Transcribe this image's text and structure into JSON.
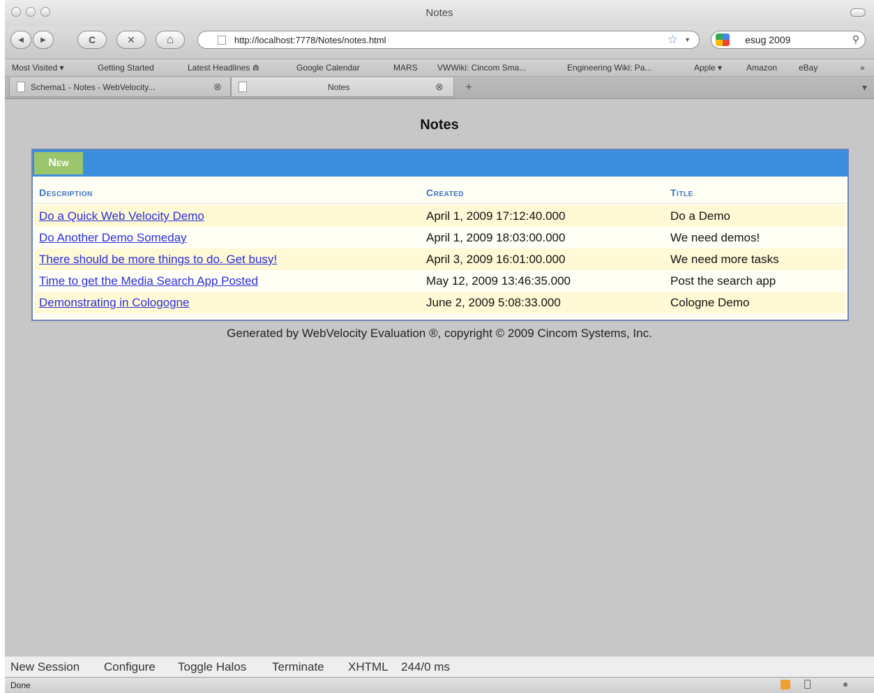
{
  "window": {
    "title": "Notes"
  },
  "toolbar": {
    "back_glyph": "◀",
    "forward_glyph": "▶",
    "reload_glyph": "C",
    "stop_glyph": "✕",
    "home_glyph": "⌂",
    "url": "http://localhost:7778/Notes/notes.html",
    "star_glyph": "☆",
    "dropdown_glyph": "▼",
    "search_value": "esug 2009",
    "search_glyph": "⚲"
  },
  "bookmarks": [
    "Most Visited ▾",
    "Getting Started",
    "Latest Headlines ⋒",
    "Google Calendar",
    "MARS",
    "VWWiki: Cincom Sma...",
    "Engineering Wiki: Pa...",
    "Apple ▾",
    "Amazon",
    "eBay",
    "»"
  ],
  "tabs": [
    {
      "label": "Schema1 - Notes - WebVelocity..."
    },
    {
      "label": "Notes"
    }
  ],
  "tab_close_glyph": "⊗",
  "new_tab_glyph": "+",
  "tab_list_glyph": "▾",
  "page": {
    "title": "Notes",
    "new_button": "New",
    "columns": [
      "Description",
      "Created",
      "Title"
    ],
    "rows": [
      {
        "description": "Do a Quick Web Velocity Demo",
        "created": "April 1, 2009 17:12:40.000",
        "title": "Do a Demo"
      },
      {
        "description": "Do Another Demo Someday",
        "created": "April 1, 2009 18:03:00.000",
        "title": "We need demos!"
      },
      {
        "description": "There should be more things to do. Get busy!",
        "created": "April 3, 2009 16:01:00.000",
        "title": "We need more tasks"
      },
      {
        "description": "Time to get the Media Search App Posted",
        "created": "May 12, 2009 13:46:35.000",
        "title": "Post the search app"
      },
      {
        "description": "Demonstrating in Cologogne",
        "created": "June 2, 2009 5:08:33.000",
        "title": "Cologne Demo"
      }
    ],
    "footer": "Generated by WebVelocity Evaluation ®, copyright © 2009 Cincom Systems, Inc."
  },
  "session_bar": [
    "New Session",
    "Configure",
    "Toggle Halos",
    "Terminate",
    "XHTML",
    "244/0 ms"
  ],
  "status": {
    "text": "Done"
  },
  "colors": {
    "panel_header": "#3b8ede",
    "new_button": "#9bc56a",
    "column_header": "#3b73c4",
    "link": "#2a2fd9",
    "row_alt": "#fff9d6"
  }
}
